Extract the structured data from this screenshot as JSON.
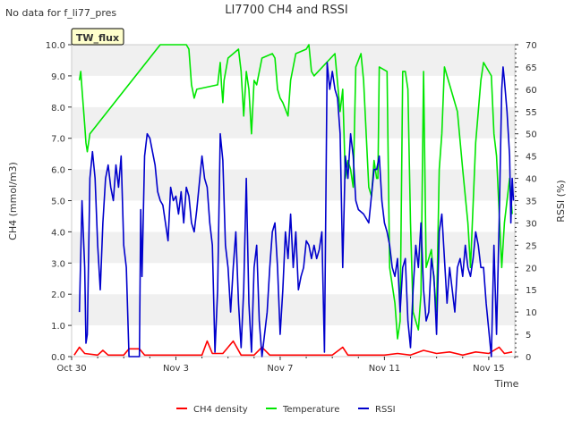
{
  "nodata_text": "No data for f_li77_pres",
  "chart_data": {
    "type": "line",
    "title": "LI7700 CH4 and RSSI",
    "xlabel": "Time",
    "ylabel_left": "CH4 (mmol/m3)",
    "ylabel_right": "RSSI (%)",
    "badge": "TW_flux",
    "xlim": [
      0,
      17.0
    ],
    "ylim_left": [
      0,
      10
    ],
    "ylim_right": [
      0,
      70
    ],
    "x_ticks": [
      {
        "x": 0,
        "label": "Oct 30"
      },
      {
        "x": 4,
        "label": "Nov 3"
      },
      {
        "x": 8,
        "label": "Nov 7"
      },
      {
        "x": 12,
        "label": "Nov 11"
      },
      {
        "x": 16,
        "label": "Nov 15"
      }
    ],
    "y_ticks_left": [
      "0.0",
      "1.0",
      "2.0",
      "3.0",
      "4.0",
      "5.0",
      "6.0",
      "7.0",
      "8.0",
      "9.0",
      "10.0"
    ],
    "y_ticks_right": [
      "0",
      "5",
      "10",
      "15",
      "20",
      "25",
      "30",
      "35",
      "40",
      "45",
      "50",
      "55",
      "60",
      "65",
      "70"
    ],
    "grid": "horizontal bands",
    "legend_position": "bottom",
    "series": [
      {
        "name": "CH4 density",
        "axis": "left",
        "color": "#ff0000",
        "points": [
          [
            0.1,
            0.05
          ],
          [
            0.3,
            0.3
          ],
          [
            0.5,
            0.1
          ],
          [
            1.0,
            0.05
          ],
          [
            1.2,
            0.2
          ],
          [
            1.4,
            0.05
          ],
          [
            2.0,
            0.05
          ],
          [
            2.2,
            0.25
          ],
          [
            2.6,
            0.25
          ],
          [
            2.8,
            0.05
          ],
          [
            3.6,
            0.05
          ],
          [
            4.2,
            0.05
          ],
          [
            5.0,
            0.05
          ],
          [
            5.2,
            0.5
          ],
          [
            5.4,
            0.1
          ],
          [
            5.8,
            0.1
          ],
          [
            6.2,
            0.5
          ],
          [
            6.5,
            0.05
          ],
          [
            7.0,
            0.05
          ],
          [
            7.3,
            0.3
          ],
          [
            7.6,
            0.05
          ],
          [
            8.2,
            0.05
          ],
          [
            9.0,
            0.05
          ],
          [
            9.5,
            0.05
          ],
          [
            10.0,
            0.05
          ],
          [
            10.4,
            0.3
          ],
          [
            10.6,
            0.05
          ],
          [
            11.5,
            0.05
          ],
          [
            12.0,
            0.05
          ],
          [
            12.5,
            0.1
          ],
          [
            13.0,
            0.05
          ],
          [
            13.5,
            0.2
          ],
          [
            14.0,
            0.1
          ],
          [
            14.5,
            0.15
          ],
          [
            15.0,
            0.05
          ],
          [
            15.5,
            0.15
          ],
          [
            16.0,
            0.1
          ],
          [
            16.4,
            0.3
          ],
          [
            16.6,
            0.1
          ],
          [
            16.9,
            0.15
          ]
        ]
      },
      {
        "name": "Temperature",
        "axis": "right",
        "color": "#00e600",
        "points": [
          [
            0.3,
            62
          ],
          [
            0.35,
            64
          ],
          [
            0.4,
            60
          ],
          [
            0.5,
            52
          ],
          [
            0.55,
            48
          ],
          [
            0.6,
            46
          ],
          [
            0.7,
            50
          ],
          [
            3.4,
            70
          ],
          [
            4.4,
            70
          ],
          [
            4.5,
            69
          ],
          [
            4.6,
            61
          ],
          [
            4.7,
            58
          ],
          [
            4.8,
            60
          ],
          [
            5.6,
            61
          ],
          [
            5.7,
            66
          ],
          [
            5.75,
            61
          ],
          [
            5.8,
            57
          ],
          [
            5.85,
            62
          ],
          [
            6.0,
            67
          ],
          [
            6.4,
            69
          ],
          [
            6.5,
            64
          ],
          [
            6.6,
            54
          ],
          [
            6.7,
            64
          ],
          [
            6.8,
            60
          ],
          [
            6.9,
            50
          ],
          [
            7.0,
            62
          ],
          [
            7.1,
            61
          ],
          [
            7.3,
            67
          ],
          [
            7.7,
            68
          ],
          [
            7.8,
            67
          ],
          [
            7.9,
            60
          ],
          [
            8.0,
            58
          ],
          [
            8.1,
            57
          ],
          [
            8.3,
            54
          ],
          [
            8.4,
            62
          ],
          [
            8.6,
            68
          ],
          [
            9.0,
            69
          ],
          [
            9.1,
            70
          ],
          [
            9.2,
            64
          ],
          [
            9.3,
            63
          ],
          [
            10.1,
            68
          ],
          [
            10.3,
            55
          ],
          [
            10.4,
            60
          ],
          [
            10.5,
            40
          ],
          [
            10.6,
            44
          ],
          [
            10.7,
            42
          ],
          [
            10.8,
            38
          ],
          [
            10.9,
            65
          ],
          [
            11.1,
            68
          ],
          [
            11.2,
            62
          ],
          [
            11.4,
            38
          ],
          [
            11.5,
            36
          ],
          [
            11.6,
            44
          ],
          [
            11.7,
            40
          ],
          [
            11.75,
            40
          ],
          [
            11.8,
            65
          ],
          [
            12.1,
            64
          ],
          [
            12.2,
            20
          ],
          [
            12.4,
            12
          ],
          [
            12.5,
            4
          ],
          [
            12.6,
            8
          ],
          [
            12.7,
            64
          ],
          [
            12.8,
            64
          ],
          [
            12.9,
            60
          ],
          [
            13.0,
            30
          ],
          [
            13.1,
            10
          ],
          [
            13.3,
            6
          ],
          [
            13.4,
            14
          ],
          [
            13.5,
            64
          ],
          [
            13.6,
            20
          ],
          [
            13.8,
            24
          ],
          [
            14.0,
            10
          ],
          [
            14.1,
            42
          ],
          [
            14.2,
            50
          ],
          [
            14.3,
            65
          ],
          [
            14.5,
            61
          ],
          [
            14.8,
            55
          ],
          [
            15.0,
            42
          ],
          [
            15.2,
            30
          ],
          [
            15.3,
            20
          ],
          [
            15.5,
            48
          ],
          [
            15.7,
            62
          ],
          [
            15.8,
            66
          ],
          [
            16.1,
            63
          ],
          [
            16.2,
            50
          ],
          [
            16.3,
            45
          ],
          [
            16.5,
            20
          ],
          [
            16.6,
            30
          ],
          [
            16.8,
            40
          ],
          [
            16.9,
            32
          ]
        ]
      },
      {
        "name": "RSSI",
        "axis": "right",
        "color": "#0000cc",
        "points": [
          [
            0.3,
            10
          ],
          [
            0.4,
            35
          ],
          [
            0.5,
            20
          ],
          [
            0.55,
            3
          ],
          [
            0.6,
            5
          ],
          [
            0.7,
            40
          ],
          [
            0.8,
            46
          ],
          [
            0.9,
            40
          ],
          [
            1.0,
            25
          ],
          [
            1.1,
            15
          ],
          [
            1.2,
            30
          ],
          [
            1.3,
            40
          ],
          [
            1.4,
            43
          ],
          [
            1.5,
            38
          ],
          [
            1.6,
            35
          ],
          [
            1.7,
            43
          ],
          [
            1.8,
            38
          ],
          [
            1.9,
            45
          ],
          [
            2.0,
            25
          ],
          [
            2.1,
            20
          ],
          [
            2.2,
            0
          ],
          [
            2.6,
            0
          ],
          [
            2.65,
            33
          ],
          [
            2.7,
            18
          ],
          [
            2.8,
            45
          ],
          [
            2.9,
            50
          ],
          [
            3.0,
            49
          ],
          [
            3.1,
            46
          ],
          [
            3.2,
            43
          ],
          [
            3.3,
            37
          ],
          [
            3.4,
            35
          ],
          [
            3.5,
            34
          ],
          [
            3.6,
            30
          ],
          [
            3.7,
            26
          ],
          [
            3.8,
            38
          ],
          [
            3.9,
            35
          ],
          [
            4.0,
            36
          ],
          [
            4.1,
            32
          ],
          [
            4.2,
            37
          ],
          [
            4.3,
            30
          ],
          [
            4.4,
            38
          ],
          [
            4.5,
            36
          ],
          [
            4.6,
            30
          ],
          [
            4.7,
            28
          ],
          [
            4.8,
            33
          ],
          [
            5.0,
            45
          ],
          [
            5.1,
            40
          ],
          [
            5.2,
            38
          ],
          [
            5.3,
            30
          ],
          [
            5.4,
            25
          ],
          [
            5.5,
            1
          ],
          [
            5.6,
            15
          ],
          [
            5.7,
            50
          ],
          [
            5.8,
            44
          ],
          [
            5.9,
            25
          ],
          [
            6.0,
            20
          ],
          [
            6.1,
            10
          ],
          [
            6.2,
            20
          ],
          [
            6.3,
            28
          ],
          [
            6.4,
            12
          ],
          [
            6.5,
            2
          ],
          [
            6.6,
            15
          ],
          [
            6.7,
            40
          ],
          [
            6.8,
            12
          ],
          [
            6.9,
            1
          ],
          [
            7.0,
            20
          ],
          [
            7.1,
            25
          ],
          [
            7.2,
            8
          ],
          [
            7.3,
            0
          ],
          [
            7.5,
            10
          ],
          [
            7.6,
            20
          ],
          [
            7.7,
            28
          ],
          [
            7.8,
            30
          ],
          [
            7.9,
            20
          ],
          [
            8.0,
            5
          ],
          [
            8.1,
            15
          ],
          [
            8.2,
            28
          ],
          [
            8.3,
            22
          ],
          [
            8.4,
            32
          ],
          [
            8.5,
            20
          ],
          [
            8.6,
            28
          ],
          [
            8.7,
            15
          ],
          [
            8.8,
            18
          ],
          [
            8.9,
            20
          ],
          [
            9.0,
            26
          ],
          [
            9.1,
            25
          ],
          [
            9.2,
            22
          ],
          [
            9.3,
            25
          ],
          [
            9.4,
            22
          ],
          [
            9.5,
            24
          ],
          [
            9.6,
            28
          ],
          [
            9.7,
            1
          ],
          [
            9.8,
            66
          ],
          [
            9.9,
            60
          ],
          [
            10.0,
            64
          ],
          [
            10.1,
            60
          ],
          [
            10.2,
            58
          ],
          [
            10.3,
            50
          ],
          [
            10.4,
            20
          ],
          [
            10.5,
            45
          ],
          [
            10.6,
            40
          ],
          [
            10.7,
            50
          ],
          [
            10.8,
            45
          ],
          [
            10.9,
            35
          ],
          [
            11.0,
            33
          ],
          [
            11.2,
            32
          ],
          [
            11.4,
            30
          ],
          [
            11.6,
            42
          ],
          [
            11.7,
            42
          ],
          [
            11.8,
            45
          ],
          [
            11.9,
            35
          ],
          [
            12.0,
            30
          ],
          [
            12.1,
            28
          ],
          [
            12.2,
            25
          ],
          [
            12.3,
            20
          ],
          [
            12.4,
            18
          ],
          [
            12.5,
            22
          ],
          [
            12.6,
            10
          ],
          [
            12.7,
            20
          ],
          [
            12.8,
            22
          ],
          [
            12.9,
            8
          ],
          [
            13.0,
            2
          ],
          [
            13.1,
            15
          ],
          [
            13.2,
            25
          ],
          [
            13.3,
            20
          ],
          [
            13.4,
            30
          ],
          [
            13.5,
            15
          ],
          [
            13.6,
            8
          ],
          [
            13.7,
            10
          ],
          [
            13.8,
            22
          ],
          [
            13.9,
            18
          ],
          [
            14.0,
            5
          ],
          [
            14.1,
            28
          ],
          [
            14.2,
            32
          ],
          [
            14.3,
            22
          ],
          [
            14.4,
            12
          ],
          [
            14.5,
            20
          ],
          [
            14.6,
            15
          ],
          [
            14.7,
            10
          ],
          [
            14.8,
            20
          ],
          [
            14.9,
            22
          ],
          [
            15.0,
            18
          ],
          [
            15.1,
            25
          ],
          [
            15.2,
            20
          ],
          [
            15.3,
            18
          ],
          [
            15.4,
            22
          ],
          [
            15.5,
            28
          ],
          [
            15.6,
            25
          ],
          [
            15.7,
            20
          ],
          [
            15.8,
            20
          ],
          [
            15.9,
            12
          ],
          [
            16.0,
            6
          ],
          [
            16.1,
            0
          ],
          [
            16.2,
            25
          ],
          [
            16.3,
            5
          ],
          [
            16.4,
            30
          ],
          [
            16.5,
            60
          ],
          [
            16.55,
            65
          ],
          [
            16.6,
            62
          ],
          [
            16.7,
            55
          ],
          [
            16.8,
            45
          ],
          [
            16.85,
            30
          ],
          [
            16.9,
            40
          ],
          [
            16.95,
            35
          ]
        ]
      }
    ]
  }
}
